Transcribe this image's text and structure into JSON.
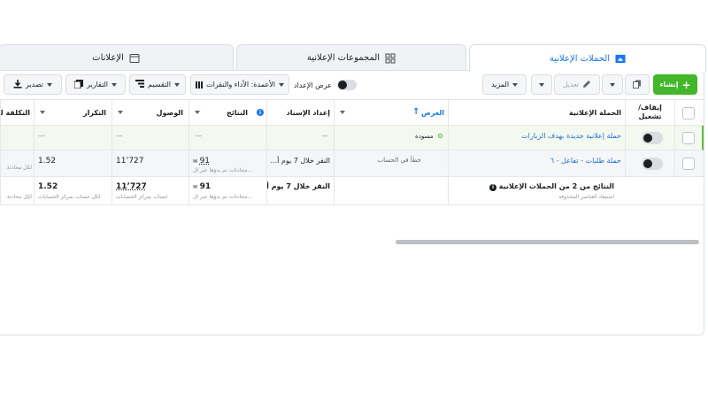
{
  "tabs": {
    "campaigns": "الحملات الإعلانية",
    "adsets": "المجموعات الإعلانية",
    "ads": "الإعلانات"
  },
  "toolbar": {
    "create": "إنشاء",
    "edit": "تعديل",
    "more": "المزيد",
    "view_setup": "عرض الإعداد",
    "columns": "الأعمدة: الأداء والنقرات",
    "breakdown": "التقسيم",
    "reports": "التقارير",
    "export": "تصدير"
  },
  "table": {
    "headers": {
      "on_off": "إيقاف/ تشغيل",
      "campaign": "الحملة الإعلانية",
      "delivery": "العرض",
      "attribution": "إعداد الإسناد",
      "results": "النتائج",
      "reach": "الوصول",
      "frequency": "التكرار",
      "cost": "التكلفة لكل"
    },
    "draft_row": {
      "campaign": "حملة إعلانية جديدة بهدف الزيارات",
      "delivery": "مسودة",
      "attribution": "—",
      "results": "—",
      "reach": "—",
      "frequency": "—"
    },
    "row2": {
      "campaign": "حملة طلبات - تفاعل - ٦",
      "delivery": "خطأ في الحساب",
      "attribution": "النقر خلال 7 يوم أ...",
      "results": "91",
      "results_sub": "محادثات تم بدؤها عبر ال...",
      "reach": "11٬727",
      "frequency": "1.52",
      "cost_sub": "لكل محادثة"
    },
    "total_row": {
      "title": "النتائج من 2 من الحملات الإعلانية",
      "subtitle": "استبعاد العناصر المحذوفة",
      "attribution": "النقر خلال 7 يوم أ...",
      "results": "91",
      "results_sub": "محادثات تم بدؤها عبر ال...",
      "reach": "11٬727",
      "reach_sub": "حساب بمركز الحسابات",
      "frequency": "1.52",
      "frequency_sub": "لكل حساب بمركز الحسابات",
      "cost_sub": "لكل محادثة"
    }
  },
  "scroll": {
    "horizontal_position": 0.56
  },
  "colors": {
    "accent": "#1877f2",
    "create_green": "#42b72a",
    "link": "#216fdb"
  }
}
